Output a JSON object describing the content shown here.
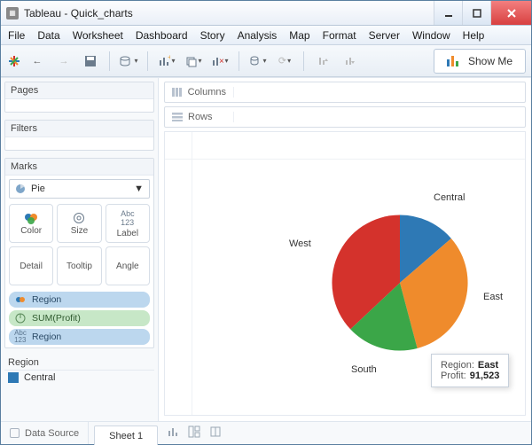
{
  "window": {
    "title": "Tableau - Quick_charts"
  },
  "menu": [
    "File",
    "Data",
    "Worksheet",
    "Dashboard",
    "Story",
    "Analysis",
    "Map",
    "Format",
    "Server",
    "Window",
    "Help"
  ],
  "showme": "Show Me",
  "shelves": {
    "columns": "Columns",
    "rows": "Rows"
  },
  "panels": {
    "pages": "Pages",
    "filters": "Filters",
    "marks": "Marks"
  },
  "marks": {
    "type": "Pie",
    "cards": {
      "color": "Color",
      "size": "Size",
      "label": "Label",
      "detail": "Detail",
      "tooltip": "Tooltip",
      "angle": "Angle"
    },
    "pills": [
      {
        "kind": "color",
        "label": "Region",
        "style": "blue"
      },
      {
        "kind": "angle",
        "label": "SUM(Profit)",
        "style": "green"
      },
      {
        "kind": "label",
        "label": "Region",
        "style": "blue"
      }
    ]
  },
  "legend": {
    "title": "Region",
    "first_item": "Central"
  },
  "bottom": {
    "data_source": "Data Source",
    "sheet": "Sheet 1"
  },
  "tooltip": {
    "k1": "Region:",
    "v1": "East",
    "k2": "Profit:",
    "v2": "91,523"
  },
  "labels": {
    "central": "Central",
    "east": "East",
    "south": "South",
    "west": "West"
  },
  "chart_data": {
    "type": "pie",
    "title": "",
    "categories": [
      "Central",
      "East",
      "South",
      "West"
    ],
    "series": [
      {
        "name": "Profit",
        "values": [
          39706,
          91523,
          46749,
          108418
        ]
      }
    ],
    "colors": {
      "Central": "#2e79b5",
      "East": "#ef8b2c",
      "South": "#3ba648",
      "West": "#d4322c"
    },
    "label_field": "Region",
    "angle_field": "SUM(Profit)"
  }
}
